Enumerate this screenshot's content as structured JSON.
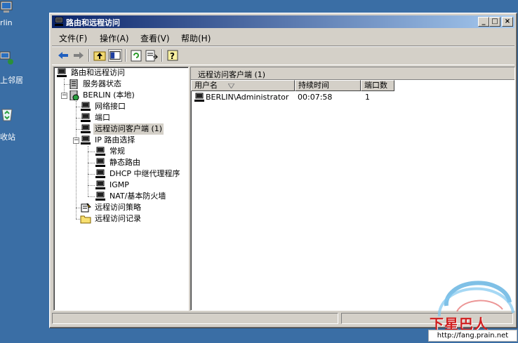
{
  "desktop": {
    "icons": [
      {
        "label": "rlin",
        "icon": "computer-icon"
      },
      {
        "label": "上邻居",
        "icon": "network-places-icon"
      },
      {
        "label": "收站",
        "icon": "recycle-bin-icon"
      }
    ]
  },
  "window": {
    "title": "路由和远程访问",
    "buttons": {
      "minimize": "_",
      "maximize": "□",
      "close": "×"
    }
  },
  "menu": {
    "items": [
      "文件(F)",
      "操作(A)",
      "查看(V)",
      "帮助(H)"
    ]
  },
  "toolbar": {
    "buttons": [
      "back-icon",
      "forward-icon",
      "up-level-icon",
      "show-hide-tree-icon",
      "refresh-icon",
      "export-list-icon",
      "help-icon"
    ]
  },
  "tree": {
    "items": [
      {
        "label": "路由和远程访问",
        "icon": "routing-icon"
      },
      {
        "label": "服务器状态",
        "icon": "server-status-icon"
      },
      {
        "label": "BERLIN (本地)",
        "icon": "server-icon"
      },
      {
        "label": "网络接口",
        "icon": "network-icon"
      },
      {
        "label": "端口",
        "icon": "network-icon"
      },
      {
        "label": "远程访问客户端 (1)",
        "icon": "network-icon"
      },
      {
        "label": "IP 路由选择",
        "icon": "network-icon"
      },
      {
        "label": "常规",
        "icon": "network-icon"
      },
      {
        "label": "静态路由",
        "icon": "network-icon"
      },
      {
        "label": "DHCP 中继代理程序",
        "icon": "network-icon"
      },
      {
        "label": "IGMP",
        "icon": "network-icon"
      },
      {
        "label": "NAT/基本防火墙",
        "icon": "network-icon"
      },
      {
        "label": "远程访问策略",
        "icon": "policy-icon"
      },
      {
        "label": "远程访问记录",
        "icon": "folder-icon"
      }
    ]
  },
  "details": {
    "header": "远程访问客户端 (1)",
    "columns": [
      "用户名",
      "持续时间",
      "端口数"
    ],
    "rows": [
      {
        "user": "BERLIN\\Administrator",
        "duration": "00:07:58",
        "ports": "1"
      }
    ]
  },
  "watermark": {
    "text": "下星巴人",
    "url": "http://fang.prain.net"
  }
}
